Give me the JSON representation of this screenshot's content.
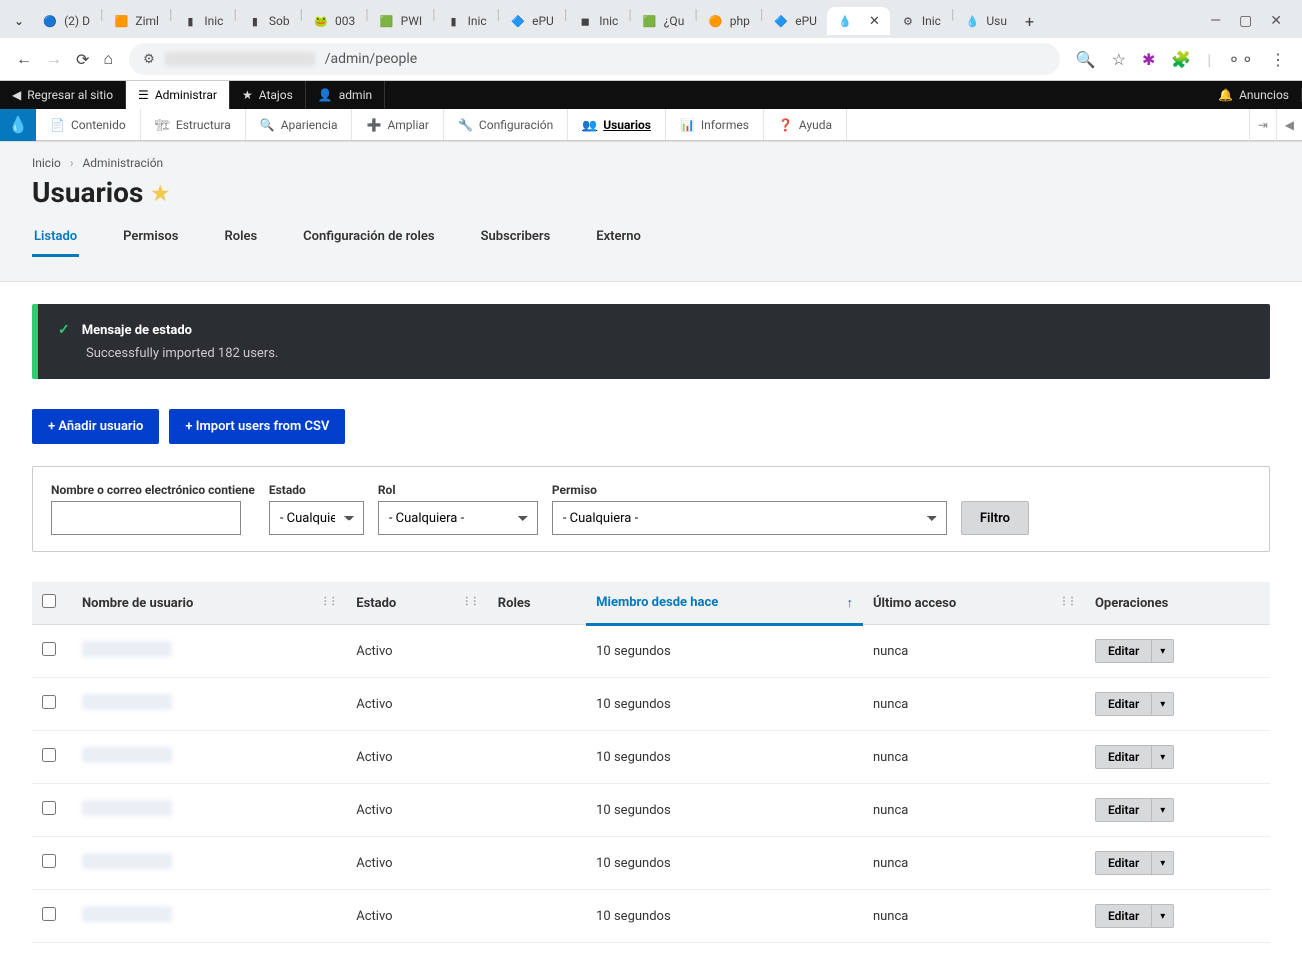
{
  "browser": {
    "tabs": [
      {
        "label": "(2) D",
        "favicon": "🔵"
      },
      {
        "label": "Ziml",
        "favicon": "🟧"
      },
      {
        "label": "Inic",
        "favicon": "▮"
      },
      {
        "label": "Sob",
        "favicon": "▮"
      },
      {
        "label": "003",
        "favicon": "🐸"
      },
      {
        "label": "PWI",
        "favicon": "🟩"
      },
      {
        "label": "Inic",
        "favicon": "▮"
      },
      {
        "label": "ePU",
        "favicon": "🔷"
      },
      {
        "label": "Inic",
        "favicon": "◼"
      },
      {
        "label": "¿Qu",
        "favicon": "🟩"
      },
      {
        "label": "php",
        "favicon": "🟠"
      },
      {
        "label": "ePU",
        "favicon": "🔷"
      },
      {
        "label": "",
        "favicon": "💧",
        "active": true
      },
      {
        "label": "Inic",
        "favicon": "⚙"
      },
      {
        "label": "Usu",
        "favicon": "💧"
      }
    ],
    "url_path": "/admin/people"
  },
  "toolbar": {
    "back_to_site": "Regresar al sitio",
    "manage": "Administrar",
    "shortcuts": "Atajos",
    "user": "admin",
    "announcements": "Anuncios"
  },
  "admin_menu": {
    "items": [
      {
        "icon": "📄",
        "label": "Contenido"
      },
      {
        "icon": "🏗",
        "label": "Estructura"
      },
      {
        "icon": "🔍",
        "label": "Apariencia"
      },
      {
        "icon": "➕",
        "label": "Ampliar"
      },
      {
        "icon": "🔧",
        "label": "Configuración"
      },
      {
        "icon": "👥",
        "label": "Usuarios",
        "active": true
      },
      {
        "icon": "📊",
        "label": "Informes"
      },
      {
        "icon": "❓",
        "label": "Ayuda"
      }
    ]
  },
  "breadcrumb": {
    "home": "Inicio",
    "admin": "Administración"
  },
  "page_title": "Usuarios",
  "local_tabs": [
    {
      "label": "Listado",
      "active": true
    },
    {
      "label": "Permisos"
    },
    {
      "label": "Roles"
    },
    {
      "label": "Configuración de roles"
    },
    {
      "label": "Subscribers"
    },
    {
      "label": "Externo"
    }
  ],
  "status": {
    "title": "Mensaje de estado",
    "body": "Successfully imported 182 users."
  },
  "actions": {
    "add_user": "+ Añadir usuario",
    "import_csv": "+ Import users from CSV"
  },
  "filters": {
    "name_label": "Nombre o correo electrónico contiene",
    "state_label": "Estado",
    "state_value": "- Cualquiera -",
    "role_label": "Rol",
    "role_value": "- Cualquiera -",
    "perm_label": "Permiso",
    "perm_value": "- Cualquiera -",
    "filter_btn": "Filtro"
  },
  "table": {
    "headers": {
      "username": "Nombre de usuario",
      "status": "Estado",
      "roles": "Roles",
      "member_since": "Miembro desde hace",
      "last_access": "Último acceso",
      "operations": "Operaciones"
    },
    "edit_label": "Editar",
    "rows": [
      {
        "status": "Activo",
        "member_since": "10 segundos",
        "last_access": "nunca"
      },
      {
        "status": "Activo",
        "member_since": "10 segundos",
        "last_access": "nunca"
      },
      {
        "status": "Activo",
        "member_since": "10 segundos",
        "last_access": "nunca"
      },
      {
        "status": "Activo",
        "member_since": "10 segundos",
        "last_access": "nunca"
      },
      {
        "status": "Activo",
        "member_since": "10 segundos",
        "last_access": "nunca"
      },
      {
        "status": "Activo",
        "member_since": "10 segundos",
        "last_access": "nunca"
      }
    ]
  }
}
